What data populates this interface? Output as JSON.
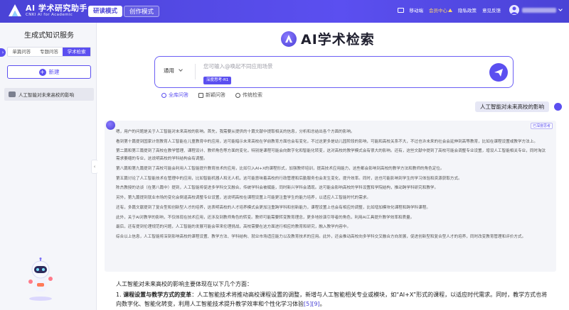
{
  "header": {
    "app_title": "AI 学术研究助手",
    "app_subtitle": "CNKI AI for Academic",
    "modes": [
      "研读模式",
      "创作模式"
    ],
    "links": {
      "mobile": "移动端",
      "member": "会员中心",
      "privacy": "隐私政策",
      "feedback": "意见反馈"
    }
  },
  "sidebar": {
    "title": "生成式知识服务",
    "tabs": [
      "单篇问答",
      "专题问答",
      "学术检索"
    ],
    "new_label": "新建",
    "history": [
      "人工智能对未来高校的影响"
    ]
  },
  "main": {
    "brand_title": "AI学术检索",
    "search": {
      "scope": "通用",
      "placeholder": "您可输入@唤起不同应用场景",
      "model_chip": "深度思考-R1"
    },
    "search_tabs": [
      "全库问答",
      "新颖问答",
      "传统检索"
    ],
    "user_question": "人工智能对未来高校的影响",
    "deep_tag": "已深度思考",
    "thinking": [
      "嗯，用户的问题是关于人工智能对未来高校的影响。首先，我需要从提供的十篇文献中提取相关的信息，分析和总结出各个方面的影响。",
      "看到第十篇提到国家计划教育人工智能在儿童教育中的应用，这可能暗示未来高校在学前教育方面也会有变化，不过这更多是幼儿园阶段的影响，可能和高校关系不大，不过也许未来的社会会延伸到高等教育，比如在课程设置或教学方法上。",
      "第二篇和第三篇提到了高校在教学管理、课程设计、教师角色等方面的变化，特别是课程可能会向数字化和智能化转变，这对高校的教学模式会有很大的影响。还有，这些文献中提到了高校可能会调整专业设置，增设人工智能相关专业，同时淘汰需求萎缩的专业，这说明高校的学科结构会有调整。",
      "第八篇和第九篇提到了高校可能会利用人工智能提升教育技术的应用，比如引入AI+X的课程形式，加强教师培训，提高技术应用能力，这些都会影响到高校的教学方法和教师的角色定位。",
      "第五篇讨论了人工智能技术在管理中的应用，比如智能机器人和无人机，这可能意味着高校的行政管理和后勤服务也会发生变化，提升效率。同时，这也可能影响到学生的学习体验和资源获取方式。",
      "陈杰教授的访谈（在第八篇中）提到，人工智能将促进多学科交叉融合，传统学科会被赋能，同时新兴学科会涌现。这可能会影响高校的学科设置和学院结构，推动跨学科研究和教学。",
      "另外，第九篇提到就业市场的变化会倒逼高校调整专业设置，这说明高校在课程设置上可能更注重学生的能力培养，以适应人工智能时代的需求。",
      "还有，多篇文献提到了复合型和创新型人才的培养，这表明高校的人才培养模式会更加注重跨学科和创新能力，课程设置上也会有相应的调整，比如增加模块化课程和跨学科课程。",
      "此外，关于AI对教学的影响，不仅体现在技术应用，还涉及到教师角色的转变。教师可能需要转变教育理念，更多地扮演引导者的角色，利用AI工具提升教学效率和质量。",
      "最后，还有提到伦理规范的问题，人工智能的发展可能会带来伦理挑战，高校需要在这方面进行相应的教育和研究，融入教学内容中。",
      "综合以上信息，人工智能将深刻影响高校的课程设置、教学方法、学科结构、就业市场适应能力以及教育技术的应用。此外，还会推动高校向多学科交叉融合方向发展，促进创新型和复合型人才的培养，同时改变教育管理和评价方式。"
    ],
    "answer_intro": "人工智能对未来高校的影响主要体现在以下几个方面：",
    "answer_point_num": "1.",
    "answer_point_title": "课程设置与教学方式的变革",
    "answer_point_text_a": "：人工智能技术将推动高校课程设置的调整，新增与人工智能相关专业或模块，如“AI+X”形式的课程，以适应时代需求。同时，教学方式也将向数字化、智能化转变，利用人工智能技术提升教学效率和个性化学习体验",
    "answer_refs": "[5][9]",
    "answer_point_end": "。"
  }
}
